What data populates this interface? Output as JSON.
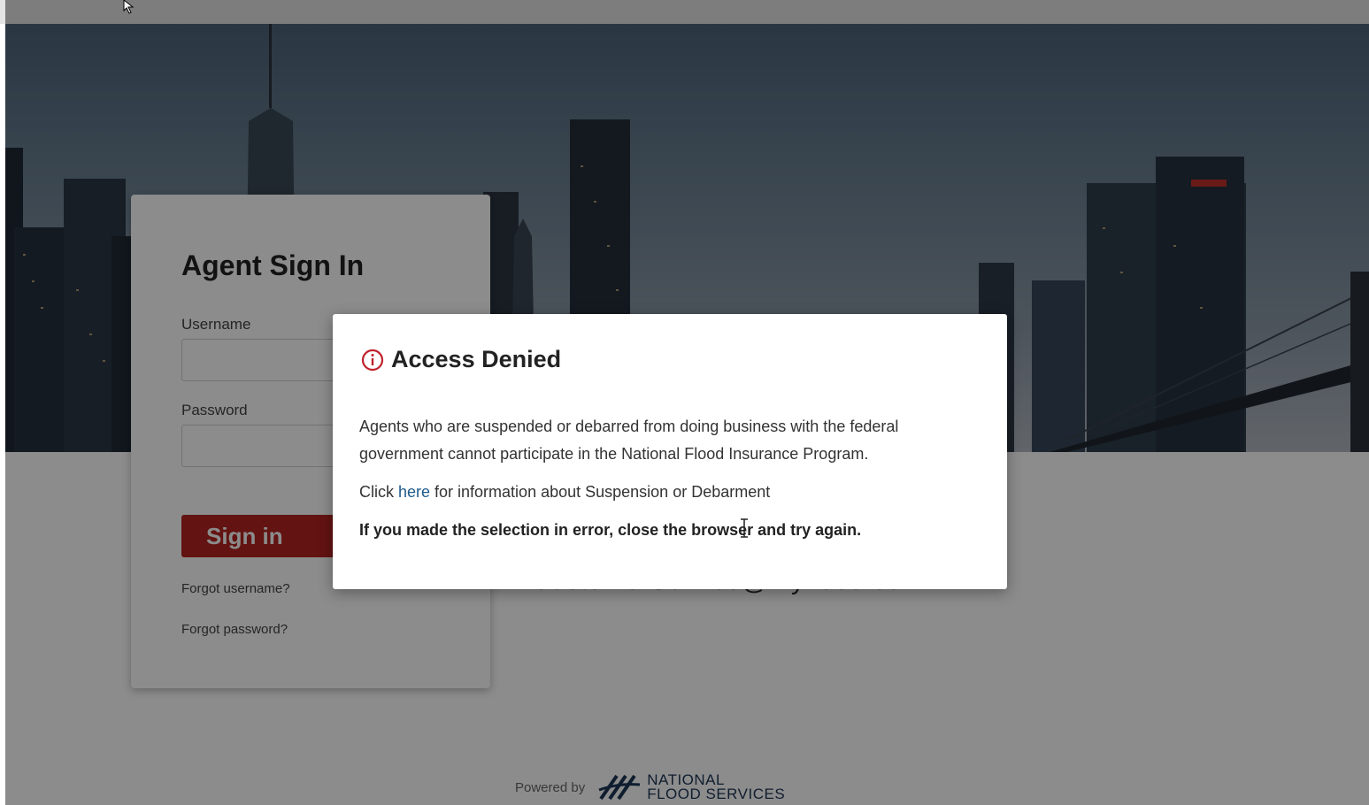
{
  "signin": {
    "title": "Agent Sign In",
    "username_label": "Username",
    "username_value": "",
    "password_label": "Password",
    "password_value": "",
    "button_label": "Sign in",
    "forgot_username": "Forgot username?",
    "forgot_password": "Forgot password?"
  },
  "contact": {
    "email_partial": "CustomerService@myflood.com"
  },
  "footer": {
    "powered_by": "Powered by",
    "logo_line1": "NATIONAL",
    "logo_line2": "FLOOD SERVICES"
  },
  "modal": {
    "title": "Access Denied",
    "icon": "info-circle-icon",
    "message": "Agents who are suspended or debarred from doing business with the federal government cannot participate in the National Flood Insurance Program.",
    "click_prefix": "Click ",
    "link_text": "here",
    "click_suffix": " for information about Suspension or Debarment",
    "warning": "If you made the selection in error, close the browser and try again."
  },
  "colors": {
    "brand_red": "#b4231f",
    "link_blue": "#1f5a8b",
    "logo_navy": "#1d3557"
  }
}
